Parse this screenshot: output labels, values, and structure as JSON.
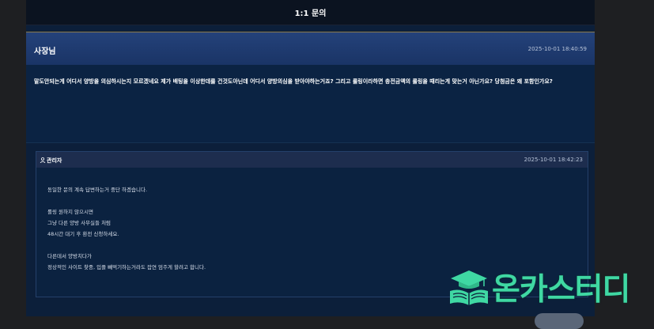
{
  "page": {
    "title": "1:1 문의"
  },
  "question": {
    "author": "사장님",
    "date": "2025-10-01 18:40:59",
    "text": "말도안되는게 어디서 양방을 의심하시는지 모르겠네요 제가 배팅을 이상한데를 건것도아닌데 어디서 양방의심을 받아야하는거죠? 그리고 롤링이라하면 충전금액의 롤링을 때리는게 맞는거 아닌가요? 당첨금은 왜 포함인가요?"
  },
  "answer": {
    "author": "관리자",
    "date": "2025-10-01 18:42:23",
    "lines": [
      "동일한 문의 계속 답변하는거 중단 하겠습니다.",
      "롤링 원하지 않으시면",
      "그냥 다른 양방 사무실들 처럼",
      "48시간 대기 후 환전 신청하세요.",
      "다른데서 양방치다가",
      "정상적인 사이트 찾중, 입플 빼먹기하는거라도 잡연 엄주게 할려고 합니다."
    ]
  },
  "watermark": {
    "text": "온카스터디",
    "icon": "graduation-cap-book-icon"
  },
  "colors": {
    "accent": "#3fd8a3",
    "header": "#1a3466",
    "panel": "#0c1f3a"
  }
}
